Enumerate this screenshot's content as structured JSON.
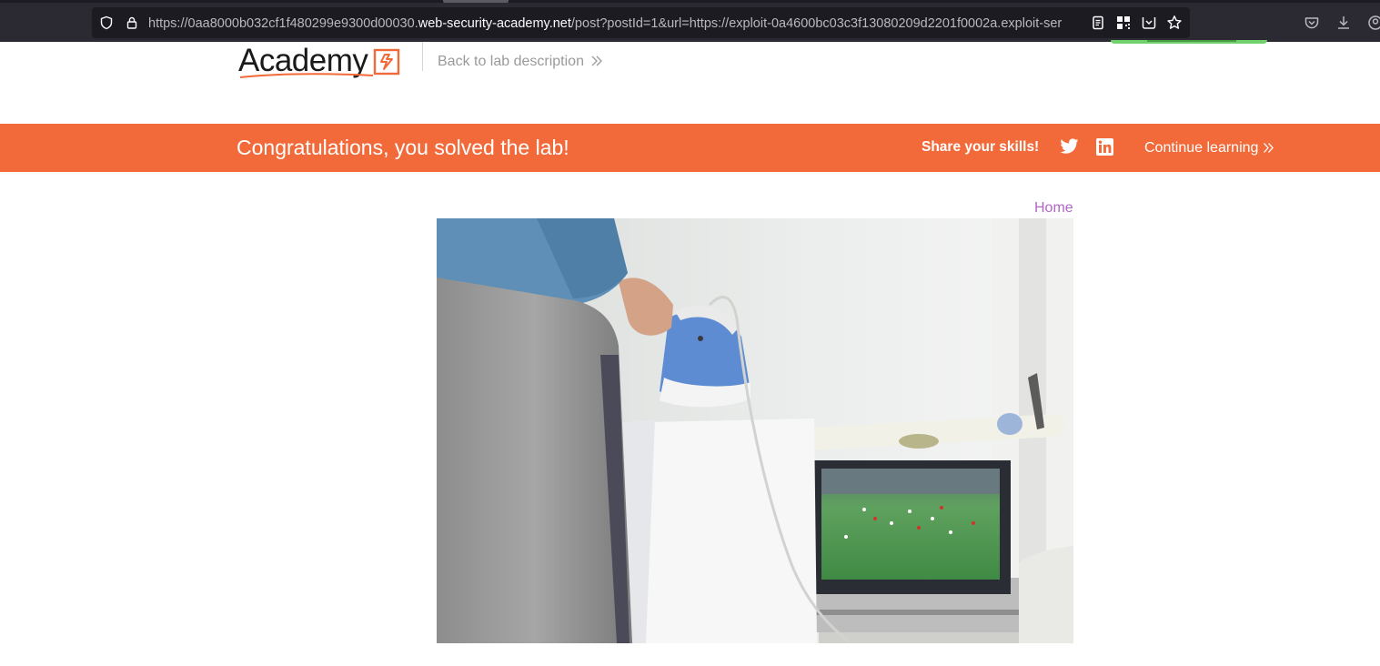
{
  "browser": {
    "url_prefix": "https://0aa8000b032cf1f480299e9300d00030.",
    "url_host": "web-security-academy.net",
    "url_path": "/post?postId=1&url=https://exploit-0a4600bc03c3f13080209d2201f0002a.exploit-ser"
  },
  "header": {
    "logo_text": "Academy",
    "back_link": "Back to lab description"
  },
  "banner": {
    "title": "Congratulations, you solved the lab!",
    "share_label": "Share your skills!",
    "continue_label": "Continue learning",
    "background": "#f26a3a"
  },
  "nav": {
    "home_label": "Home"
  },
  "post": {
    "image_icon": "post-image"
  },
  "colors": {
    "accent": "#f26a3a",
    "home_link": "#b266c8",
    "lab_status": "#70d16d"
  }
}
